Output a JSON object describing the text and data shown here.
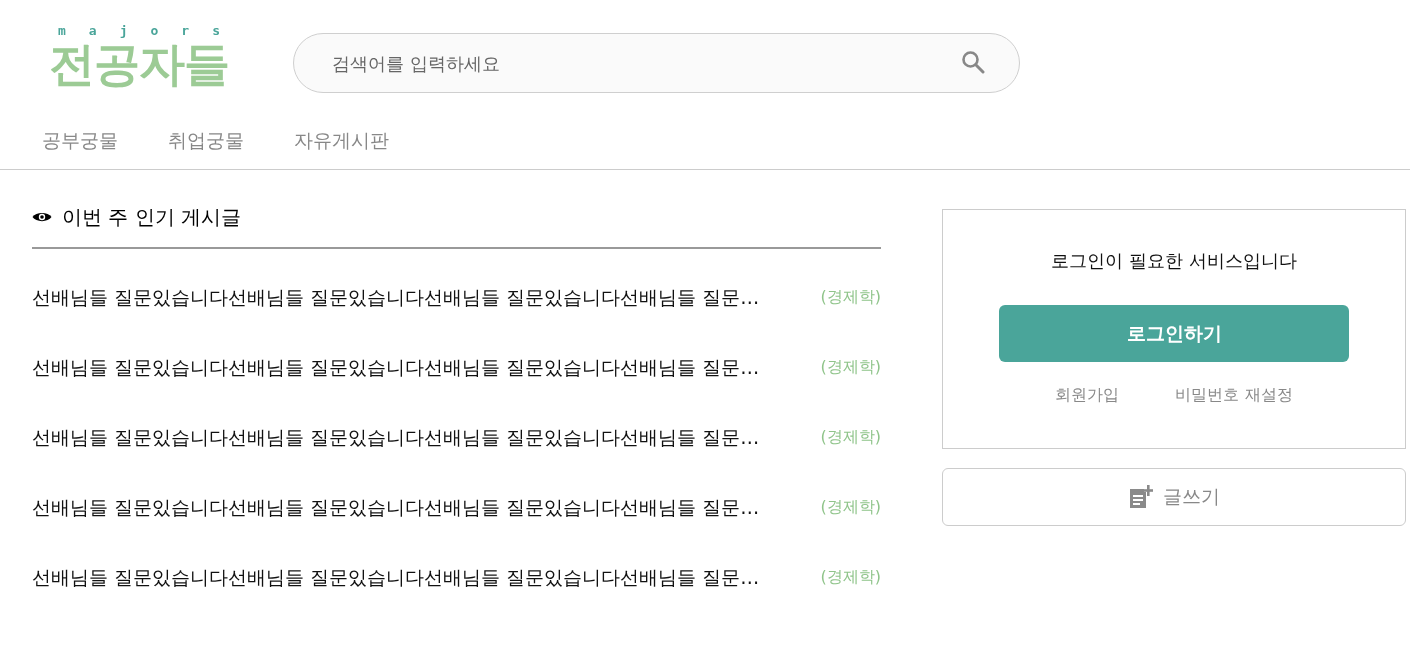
{
  "header": {
    "logo": {
      "subtitle": "majors",
      "title": "전공자들"
    },
    "search": {
      "placeholder": "검색어를 입력하세요"
    }
  },
  "nav": {
    "tabs": [
      {
        "label": "공부궁물"
      },
      {
        "label": "취업궁물"
      },
      {
        "label": "자유게시판"
      }
    ]
  },
  "popular": {
    "title": "이번 주 인기 게시글",
    "posts": [
      {
        "title": "선배님들 질문있습니다선배님들 질문있습니다선배님들 질문있습니다선배님들 질문…",
        "category": "(경제학)"
      },
      {
        "title": "선배님들 질문있습니다선배님들 질문있습니다선배님들 질문있습니다선배님들 질문…",
        "category": "(경제학)"
      },
      {
        "title": "선배님들 질문있습니다선배님들 질문있습니다선배님들 질문있습니다선배님들 질문…",
        "category": "(경제학)"
      },
      {
        "title": "선배님들 질문있습니다선배님들 질문있습니다선배님들 질문있습니다선배님들 질문…",
        "category": "(경제학)"
      },
      {
        "title": "선배님들 질문있습니다선배님들 질문있습니다선배님들 질문있습니다선배님들 질문…",
        "category": "(경제학)"
      }
    ]
  },
  "login_card": {
    "message": "로그인이 필요한 서비스입니다",
    "login_button": "로그인하기",
    "links": [
      "회원가입",
      "비밀번호 재설정"
    ]
  },
  "write_button": {
    "label": "글쓰기"
  }
}
